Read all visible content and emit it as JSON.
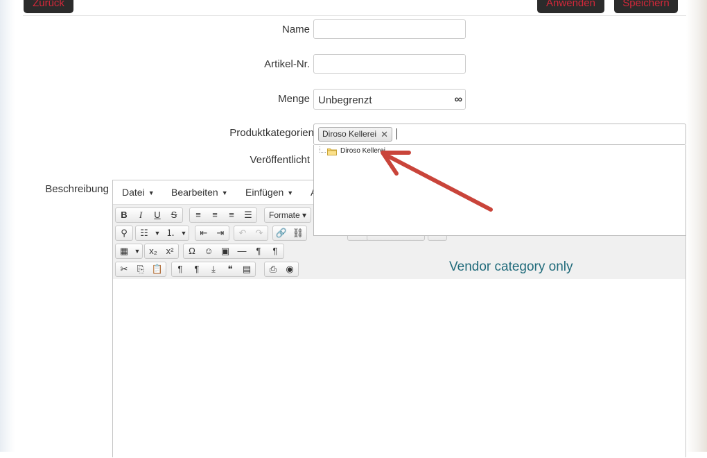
{
  "toolbar": {
    "back_label": "Zurück",
    "apply_label": "Anwenden",
    "save_label": "Speichern"
  },
  "form": {
    "name_label": "Name",
    "name_value": "",
    "sku_label": "Artikel-Nr.",
    "sku_value": "",
    "quantity_label": "Menge",
    "quantity_value": "Unbegrenzt",
    "quantity_icon": "infinity-icon",
    "quantity_symbol": "∞",
    "categories_label": "Produktkategorien",
    "categories_selected": [
      "Diroso Kellerei"
    ],
    "published_label": "Veröffentlicht",
    "description_label": "Beschreibung"
  },
  "category_dropdown": {
    "items": [
      {
        "label": "Diroso Kellerei",
        "icon": "folder-icon"
      }
    ]
  },
  "editor": {
    "menu": [
      "Datei",
      "Bearbeiten",
      "Einfügen",
      "A"
    ],
    "format_label": "Formate",
    "annotation": "Vendor category only"
  },
  "colors": {
    "button_bg": "#2b2b2b",
    "button_text": "#d4283a",
    "annotation_arrow": "#c9443a",
    "annotation_text": "#1f6a7a"
  }
}
